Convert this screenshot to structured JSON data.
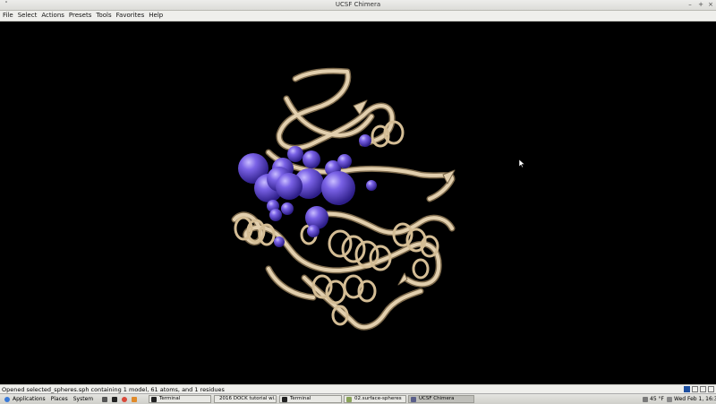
{
  "window": {
    "title": "UCSF Chimera"
  },
  "menu": [
    "File",
    "Select",
    "Actions",
    "Presets",
    "Tools",
    "Favorites",
    "Help"
  ],
  "status": {
    "text": "Opened selected_spheres.sph containing 1 model, 61 atoms, and 1 residues"
  },
  "taskbar": {
    "applications": "Applications",
    "places": "Places",
    "system": "System",
    "tasks": [
      {
        "label": "Terminal",
        "icon": "terminal-icon"
      },
      {
        "label": "2016 DOCK tutorial wi...",
        "icon": "chrome-icon"
      },
      {
        "label": "Terminal",
        "icon": "terminal-icon"
      },
      {
        "label": "02.surface-spheres",
        "icon": "folder-icon"
      },
      {
        "label": "UCSF Chimera",
        "icon": "chimera-icon"
      }
    ],
    "weather": "45 °F",
    "clock": "Wed Feb 1, 16:32"
  },
  "colors": {
    "ribbon": "#d9c4a0",
    "sphere": "#6a55d6",
    "background": "#000000"
  }
}
